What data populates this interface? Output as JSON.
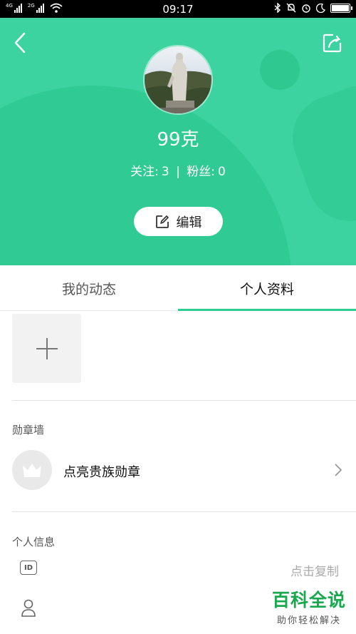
{
  "status_bar": {
    "left_labels": [
      "4G",
      "2G"
    ],
    "time": "09:17",
    "icons": [
      "bluetooth-icon",
      "silent-bell-icon",
      "alarm-icon",
      "moon-icon",
      "battery-icon"
    ]
  },
  "header": {
    "username": "99克",
    "follow_label": "关注:",
    "follow_count": "3",
    "separator": "|",
    "fans_label": "粉丝:",
    "fans_count": "0",
    "edit_label": "编辑",
    "accent_color": "#3dd3a0"
  },
  "tabs": [
    {
      "label": "我的动态",
      "active": false
    },
    {
      "label": "个人资料",
      "active": true
    }
  ],
  "medal_wall": {
    "title": "勋章墙",
    "item_label": "点亮贵族勋章"
  },
  "personal_info": {
    "title": "个人信息",
    "id_icon_text": "ID",
    "copy_label": "点击复制"
  },
  "watermark": {
    "title": "百科全说",
    "subtitle": "助你轻松解决"
  }
}
